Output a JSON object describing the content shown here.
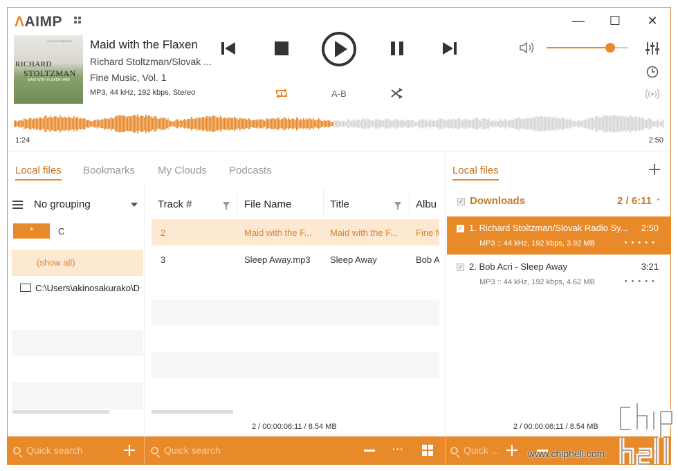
{
  "app": {
    "name": "AIMP",
    "window_controls": {
      "minimize": "—",
      "maximize": "☐",
      "close": "✕"
    }
  },
  "now_playing": {
    "title": "Maid with the Flaxen",
    "artist": "Richard Stoltzman/Slovak ...",
    "album": "Fine Music, Vol. 1",
    "format": "MP3, 44 kHz, 192 kbps, Stereo",
    "cover": {
      "line1": "RICHARD",
      "line2": "STOLTZMAN",
      "line3": "MAID WITH FLAXEN HAIR",
      "line4": "CLAUDE DEBUSSY"
    },
    "elapsed": "1:24",
    "duration": "2:50",
    "progress": 0.49,
    "volume": 0.78
  },
  "controls": {
    "ab_label": "A-B"
  },
  "tabs": [
    {
      "label": "Local files",
      "active": true
    },
    {
      "label": "Bookmarks",
      "active": false
    },
    {
      "label": "My Clouds",
      "active": false
    },
    {
      "label": "Podcasts",
      "active": false
    }
  ],
  "browser": {
    "grouping": "No grouping",
    "star_label": "*",
    "drive": "C",
    "show_all": "(show all)",
    "folder_path": "C:\\Users\\akinosakurako\\D"
  },
  "file_table": {
    "columns": [
      "Track #",
      "File Name",
      "Title",
      "Albu"
    ],
    "rows": [
      {
        "track": "2",
        "file": "Maid with the F...",
        "title": "Maid with the F...",
        "album": "Fine M",
        "selected": true
      },
      {
        "track": "3",
        "file": "Sleep Away.mp3",
        "title": "Sleep Away",
        "album": "Bob A",
        "selected": false
      }
    ],
    "summary": "2 / 00:00:06:11 / 8.54 MB"
  },
  "playlist": {
    "tab_label": "Local files",
    "group_name": "Downloads",
    "group_count": "2 / 6:11",
    "items": [
      {
        "name": "1. Richard Stoltzman/Slovak Radio Sy...",
        "duration": "2:50",
        "meta": "MP3 :: 44 kHz, 192 kbps, 3.92 MB",
        "selected": true
      },
      {
        "name": "2. Bob Acri - Sleep Away",
        "duration": "3:21",
        "meta": "MP3 :: 44 kHz, 192 kbps, 4.62 MB",
        "selected": false
      }
    ],
    "summary": "2 / 00:00:06:11 / 8.54 MB"
  },
  "footer": {
    "search_left": "Quick search",
    "search_middle": "Quick search",
    "search_right": "Quick ..."
  },
  "watermark": "www.chiphell.com",
  "colors": {
    "accent": "#e8892a",
    "selection": "#fde8d1"
  }
}
